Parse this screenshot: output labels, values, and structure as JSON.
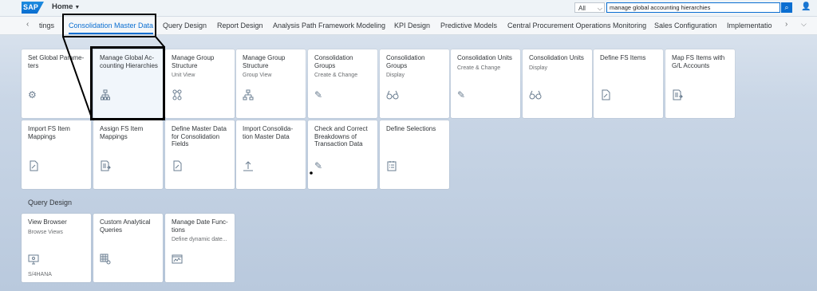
{
  "shell": {
    "logo": "SAP",
    "home_label": "Home",
    "scope": "All",
    "search_value": "manage global accounting hierarchies"
  },
  "tabs": {
    "items": [
      "tings",
      "Consolidation Master Data",
      "Query Design",
      "Report Design",
      "Analysis Path Framework Modeling",
      "KPI Design",
      "Predictive Models",
      "Central Procurement Operations Monitoring",
      "Sales Configuration",
      "Implementatio"
    ],
    "active_index": 1
  },
  "tiles_row1": [
    {
      "title": "Set Global Parame-ters",
      "subtitle": "",
      "icon": "gears-icon"
    },
    {
      "title": "Manage Global Ac-counting Hierarchies",
      "subtitle": "",
      "icon": "hierarchy-icon"
    },
    {
      "title": "Manage Group Structure",
      "subtitle": "Unit View",
      "icon": "org-structure-icon"
    },
    {
      "title": "Manage Group Structure",
      "subtitle": "Group View",
      "icon": "org-chart-icon"
    },
    {
      "title": "Consolidation Groups",
      "subtitle": "Create & Change",
      "icon": "edit-icon"
    },
    {
      "title": "Consolidation Groups",
      "subtitle": "Display",
      "icon": "display-icon"
    },
    {
      "title": "Consolidation Units",
      "subtitle": "Create & Change",
      "icon": "edit-icon"
    },
    {
      "title": "Consolidation Units",
      "subtitle": "Display",
      "icon": "display-icon"
    },
    {
      "title": "Define FS Items",
      "subtitle": "",
      "icon": "document-icon"
    },
    {
      "title": "Map FS Items with G/L Accounts",
      "subtitle": "",
      "icon": "mapping-icon"
    }
  ],
  "tiles_row2": [
    {
      "title": "Import FS Item Mappings",
      "subtitle": "",
      "icon": "document-icon"
    },
    {
      "title": "Assign FS Item Mappings",
      "subtitle": "",
      "icon": "mapping-icon"
    },
    {
      "title": "Define Master Data for Consolidation Fields",
      "subtitle": "",
      "icon": "document-icon"
    },
    {
      "title": "Import Consolida-tion Master Data",
      "subtitle": "",
      "icon": "upload-icon"
    },
    {
      "title": "Check and Correct Breakdowns of Transaction Data",
      "subtitle": "",
      "icon": "edit-icon"
    },
    {
      "title": "Define Selections",
      "subtitle": "",
      "icon": "list-icon"
    }
  ],
  "section_query_design": "Query Design",
  "tiles_row3": [
    {
      "title": "View Browser",
      "subtitle": "Browse Views",
      "icon": "monitor-icon",
      "footer": "S/4HANA"
    },
    {
      "title": "Custom Analytical Queries",
      "subtitle": "",
      "icon": "table-gear-icon",
      "footer": ""
    },
    {
      "title": "Manage Date Func-tions",
      "subtitle": "Define dynamic date...",
      "icon": "chart-window-icon",
      "footer": ""
    }
  ],
  "colors": {
    "accent": "#0a6ed1",
    "annotation": "#000000"
  }
}
